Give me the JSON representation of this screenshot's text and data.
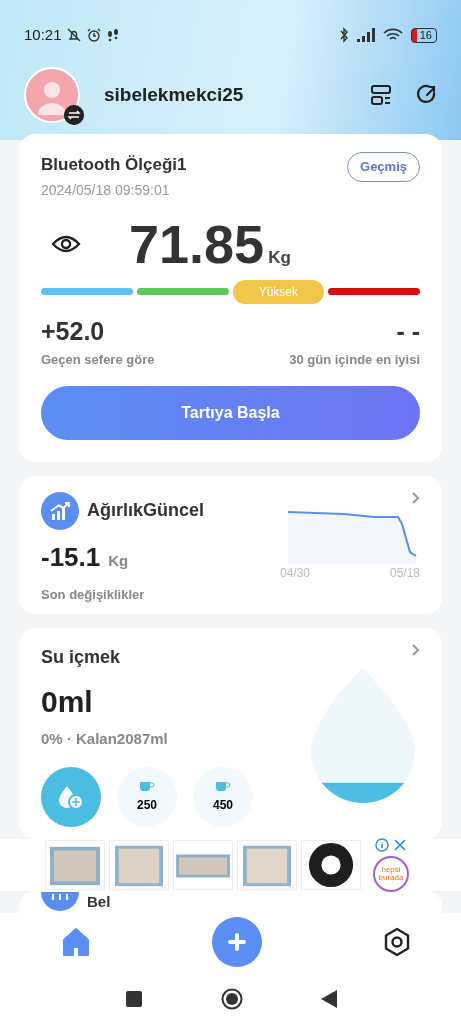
{
  "status_bar": {
    "time": "10:21",
    "battery": "16"
  },
  "header": {
    "username": "sibelekmekci25"
  },
  "scale_card": {
    "device": "Bluetooth Ölçeği1",
    "history_button": "Geçmiş",
    "datetime": "2024/05/18 09:59:01",
    "weight": "71.85",
    "unit": "Kg",
    "scale": [
      {
        "color": "#5bc4ef",
        "selected": false
      },
      {
        "color": "#5cc95e",
        "selected": false
      },
      {
        "color": "#f2c64a",
        "selected": true,
        "label": "Yüksek"
      },
      {
        "color": "#d90d0d",
        "selected": false
      }
    ],
    "change": "+52.0",
    "change_label": "Geçen sefere göre",
    "best": "- -",
    "best_label": "30 gün içinde en iyisi",
    "start_button": "Tartıya Başla"
  },
  "weight_card": {
    "title": "AğırlıkGüncel",
    "value": "-15.1",
    "unit": "Kg",
    "caption": "Son değişiklikler",
    "trend_start": "04/30",
    "trend_end": "05/18"
  },
  "water_card": {
    "title": "Su içmek",
    "amount": "0ml",
    "summary": "0% · Kalan2087ml",
    "cups": [
      {
        "amount": "250"
      },
      {
        "amount": "450"
      }
    ]
  },
  "next_card": {
    "title": "Bel"
  },
  "ad": {
    "brand": "hepsi burada"
  },
  "bottom_nav": [
    {
      "kind": "home",
      "selected": true
    },
    {
      "kind": "add",
      "selected": false
    },
    {
      "kind": "settings",
      "selected": false
    }
  ]
}
